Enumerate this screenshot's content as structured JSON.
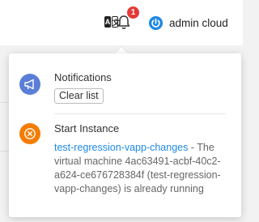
{
  "header": {
    "translate_icon": "translate-icon",
    "bell_icon": "bell-icon",
    "notification_count": "1",
    "power_icon": "power-icon",
    "user_name": "admin cloud",
    "accent_color": "#1e88e5"
  },
  "notifications_panel": {
    "title": "Notifications",
    "clear_label": "Clear list",
    "items": [
      {
        "icon": "cancel-icon",
        "icon_color": "#f57c00",
        "title": "Start Instance",
        "link_text": "test-regression-vapp-changes",
        "message": " - The virtual machine 4ac63491-acbf-40c2-a624-ce676728384f (test-regression-vapp-changes) is already running"
      }
    ]
  }
}
